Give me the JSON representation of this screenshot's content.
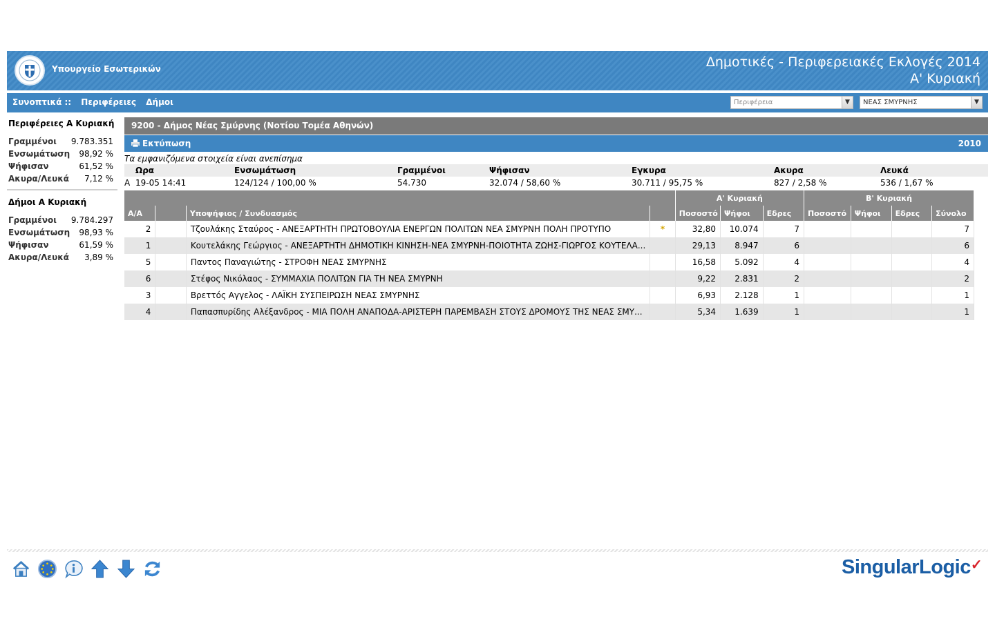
{
  "header": {
    "ministry": "Υπουργείο Εσωτερικών",
    "title_line1": "Δημοτικές - Περιφερειακές Εκλογές 2014",
    "title_line2": "Α' Κυριακή"
  },
  "nav": {
    "summary": "Συνοπτικά ::",
    "regions": "Περιφέρειες",
    "municipalities": "Δήμοι"
  },
  "selects": {
    "region_placeholder": "Περιφέρεια",
    "municipality_value": "ΝΕΑΣ ΣΜΥΡΝΗΣ"
  },
  "sidebar": {
    "regions": {
      "title": "Περιφέρειες Α Κυριακή",
      "rows": [
        {
          "label": "Γραμμένοι",
          "value": "9.783.351"
        },
        {
          "label": "Ενσωμάτωση",
          "value": "98,92 %"
        },
        {
          "label": "Ψήφισαν",
          "value": "61,52 %"
        },
        {
          "label": "Ακυρα/Λευκά",
          "value": "7,12 %"
        }
      ]
    },
    "municipalities": {
      "title": "Δήμοι Α Κυριακή",
      "rows": [
        {
          "label": "Γραμμένοι",
          "value": "9.784.297"
        },
        {
          "label": "Ενσωμάτωση",
          "value": "98,93 %"
        },
        {
          "label": "Ψήφισαν",
          "value": "61,59 %"
        },
        {
          "label": "Ακυρα/Λευκά",
          "value": "3,89 %"
        }
      ]
    }
  },
  "main": {
    "municipality_title": "9200 - Δήμος Νέας Σμύρνης (Νοτίου Τομέα Αθηνών)",
    "print_label": "Εκτύπωση",
    "year": "2010",
    "notice": "Τα εμφανιζόμενα στοιχεία είναι ανεπίσημα"
  },
  "summary": {
    "headers": {
      "time": "Ωρα",
      "integration": "Ενσωμάτωση",
      "registered": "Γραμμένοι",
      "voted": "Ψήφισαν",
      "valid": "Εγκυρα",
      "invalid": "Ακυρα",
      "blank": "Λευκά"
    },
    "values": {
      "round": "Α",
      "time": "19-05 14:41",
      "integration": "124/124 / 100,00 %",
      "registered": "54.730",
      "voted": "32.074 / 58,60 %",
      "valid": "30.711 / 95,75 %",
      "invalid": "827 / 2,58 %",
      "blank": "536 / 1,67 %"
    }
  },
  "table": {
    "group_a": "Α' Κυριακή",
    "group_b": "Β' Κυριακή",
    "col_aa": "Α/Α",
    "col_candidate": "Υποψήφιος / Συνδυασμός",
    "col_pct": "Ποσοστό",
    "col_votes": "Ψήφοι",
    "col_seats": "Εδρες",
    "col_total": "Σύνολο",
    "rows": [
      {
        "aa": "2",
        "name": "Τζουλάκης Σταύρος - ΑΝΕΞΑΡΤΗΤΗ ΠΡΩΤΟΒΟΥΛΙΑ ΕΝΕΡΓΩΝ ΠΟΛΙΤΩΝ ΝΕΑ ΣΜΥΡΝΗ ΠΟΛΗ ΠΡΟΤΥΠΟ",
        "star": "*",
        "pct": "32,80",
        "votes": "10.074",
        "seats": "7",
        "total": "7"
      },
      {
        "aa": "1",
        "name": "Κουτελάκης Γεώργιος - ΑΝΕΞΑΡΤΗΤΗ ΔΗΜΟΤΙΚΗ ΚΙΝΗΣΗ-ΝΕΑ ΣΜΥΡΝΗ-ΠΟΙΟΤΗΤΑ ΖΩΗΣ-ΓΙΩΡΓΟΣ ΚΟΥΤΕΛΑ...",
        "star": "",
        "pct": "29,13",
        "votes": "8.947",
        "seats": "6",
        "total": "6"
      },
      {
        "aa": "5",
        "name": "Παντος Παναγιώτης - ΣΤΡΟΦΗ ΝΕΑΣ ΣΜΥΡΝΗΣ",
        "star": "",
        "pct": "16,58",
        "votes": "5.092",
        "seats": "4",
        "total": "4"
      },
      {
        "aa": "6",
        "name": "Στέφος Νικόλαος - ΣΥΜΜΑΧΙΑ ΠΟΛΙΤΩΝ ΓΙΑ ΤΗ ΝΕΑ ΣΜΥΡΝΗ",
        "star": "",
        "pct": "9,22",
        "votes": "2.831",
        "seats": "2",
        "total": "2"
      },
      {
        "aa": "3",
        "name": "Βρεττός Αγγελος - ΛΑΪΚΗ ΣΥΣΠΕΙΡΩΣΗ ΝΕΑΣ ΣΜΥΡΝΗΣ",
        "star": "",
        "pct": "6,93",
        "votes": "2.128",
        "seats": "1",
        "total": "1"
      },
      {
        "aa": "4",
        "name": "Παπασπυρίδης Αλέξανδρος - ΜΙΑ ΠΟΛΗ ΑΝΑΠΟΔΑ-ΑΡΙΣΤΕΡΗ ΠΑΡΕΜΒΑΣΗ ΣΤΟΥΣ ΔΡΟΜΟΥΣ ΤΗΣ ΝΕΑΣ ΣΜΥ...",
        "star": "",
        "pct": "5,34",
        "votes": "1.639",
        "seats": "1",
        "total": "1"
      }
    ]
  },
  "footer": {
    "icons": [
      "home-icon",
      "europe-icon",
      "info-icon",
      "arrow-up-icon",
      "arrow-down-icon",
      "refresh-icon"
    ],
    "brand_part1": "Singular",
    "brand_part2": "Logic"
  }
}
